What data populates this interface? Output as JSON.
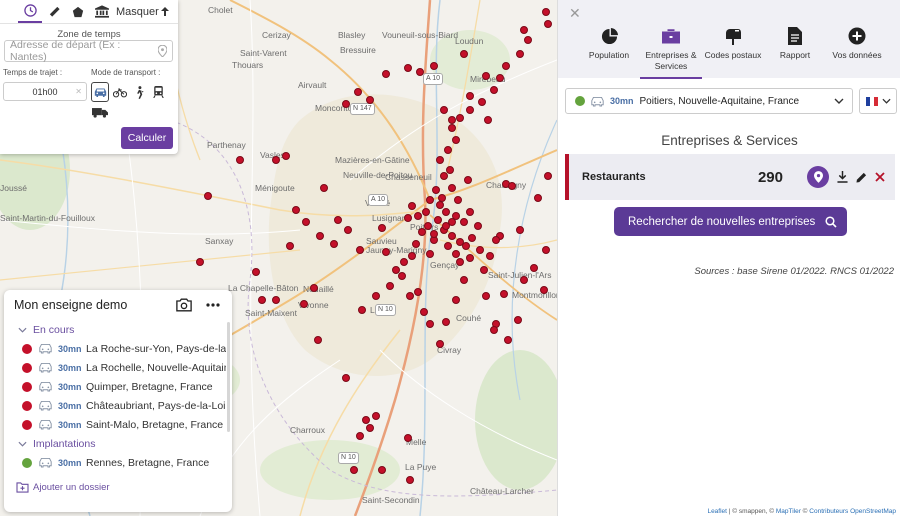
{
  "map": {
    "places": [
      "Cholet",
      "Cerizay",
      "Bressuire",
      "Blasley",
      "Vouneuil-sous-Biard",
      "Saint-Varent",
      "Thouars",
      "Loudun",
      "Airvault",
      "Mirebeau",
      "Moncontour",
      "Parthenay",
      "Mazières-en-Gâtine",
      "Neuville-de-Poitou",
      "Saint-Martin-du-Fouilloux",
      "Vasles",
      "Ménigoute",
      "Vouillé",
      "Lusignan",
      "Chasseneuil",
      "Poitiers",
      "Chauvigny",
      "Sanxay",
      "Sauvieu",
      "Jaunay-Marigny",
      "La Chapelle-Bâton",
      "Nouaillé",
      "Gençay",
      "Vivonne",
      "Couhé",
      "Saint-Maixent",
      "Lezay",
      "Civray",
      "Charroux",
      "Melle",
      "Montmorillon",
      "Saint-Julien-l'Ars",
      "La Puye",
      "Château-Larcher",
      "Saint-Secondin",
      "Joussé"
    ],
    "roads": [
      "A 10",
      "A 10",
      "N 10",
      "N 10",
      "N 147"
    ]
  },
  "zone_panel": {
    "hide_label": "Masquer",
    "title": "Zone de temps",
    "address_placeholder": "Adresse de départ (Ex : Nantes)",
    "time_label": "Temps de trajet :",
    "time_value": "01h00",
    "mode_label": "Mode de transport :",
    "calc_button": "Calculer"
  },
  "store_panel": {
    "title": "Mon enseigne demo",
    "group_current": "En cours",
    "current": [
      {
        "duration": "30mn",
        "location": "La Roche-sur-Yon, Pays-de-la-Loire, France"
      },
      {
        "duration": "30mn",
        "location": "La Rochelle, Nouvelle-Aquitaine, France"
      },
      {
        "duration": "30mn",
        "location": "Quimper, Bretagne, France"
      },
      {
        "duration": "30mn",
        "location": "Châteaubriant, Pays-de-la-Loire, France"
      },
      {
        "duration": "30mn",
        "location": "Saint-Malo, Bretagne, France"
      }
    ],
    "group_impl": "Implantations",
    "implantations": [
      {
        "duration": "30mn",
        "location": "Rennes, Bretagne, France"
      }
    ],
    "add_folder": "Ajouter un dossier",
    "colors": {
      "current": "#c4102a",
      "impl": "#64a33d"
    }
  },
  "right_panel": {
    "tabs": [
      {
        "label": "Population",
        "icon": "pie-chart-icon"
      },
      {
        "label": "Entreprises & Services",
        "icon": "briefcase-icon",
        "active": true
      },
      {
        "label": "Codes postaux",
        "icon": "mailbox-icon"
      },
      {
        "label": "Rapport",
        "icon": "document-icon"
      },
      {
        "label": "Vos données",
        "icon": "plus-circle-icon"
      }
    ],
    "selected_location": {
      "duration": "30mn",
      "name": "Poitiers, Nouvelle-Aquitaine, France"
    },
    "section_title": "Entreprises & Services",
    "card": {
      "name": "Restaurants",
      "count": "290"
    },
    "search_button": "Rechercher de nouvelles entreprises",
    "sources": "Sources : base Sirene 01/2022. RNCS 01/2022",
    "attribution": {
      "leaflet": "Leaflet",
      "rest": " | © smappen, © ",
      "maptiler": "MapTiler",
      "osm_prefix": " © ",
      "osm": "Contributeurs OpenStreetMap"
    },
    "accent_color": "#6a3ea1"
  }
}
